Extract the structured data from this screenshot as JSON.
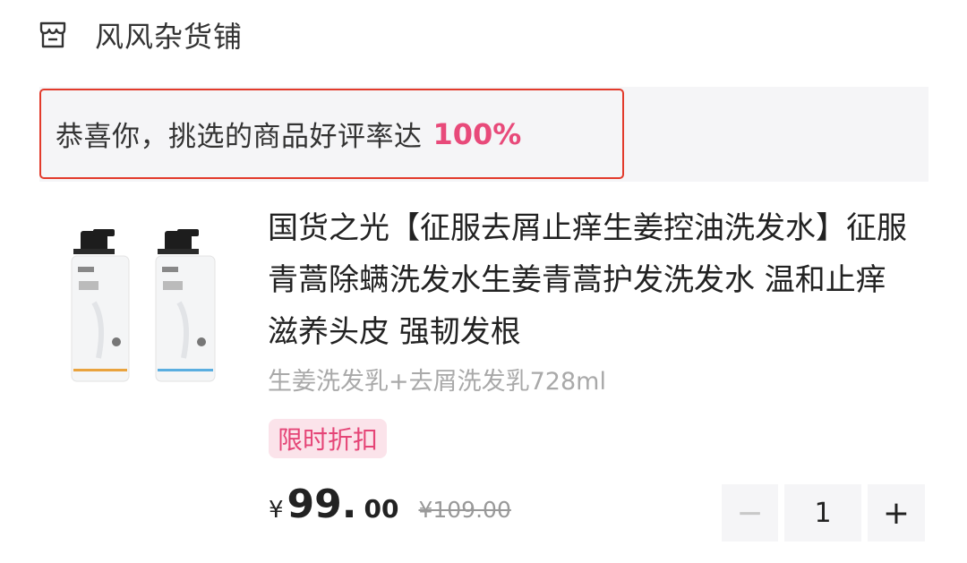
{
  "store": {
    "icon": "store-icon",
    "name": "风风杂货铺"
  },
  "banner": {
    "text": "恭喜你，挑选的商品好评率达",
    "rate": "100%"
  },
  "product": {
    "image_icon": "shampoo-bottles-image",
    "title": "国货之光【征服去屑止痒生姜控油洗发水】征服青蒿除螨洗发水生姜青蒿护发洗发水 温和止痒 滋养头皮 强韧发根",
    "spec": "生姜洗发乳+去屑洗发乳728ml",
    "tag": "限时折扣",
    "price": {
      "symbol": "¥",
      "integer": "99.",
      "decimal": "00",
      "original": "¥109.00"
    },
    "quantity": {
      "minus": "−",
      "value": "1",
      "plus": "+"
    }
  },
  "colors": {
    "highlight_border": "#e23a2b",
    "accent_pink": "#e84a7a",
    "tag_bg": "#fbe3ea",
    "banner_bg": "#f5f5f7"
  }
}
